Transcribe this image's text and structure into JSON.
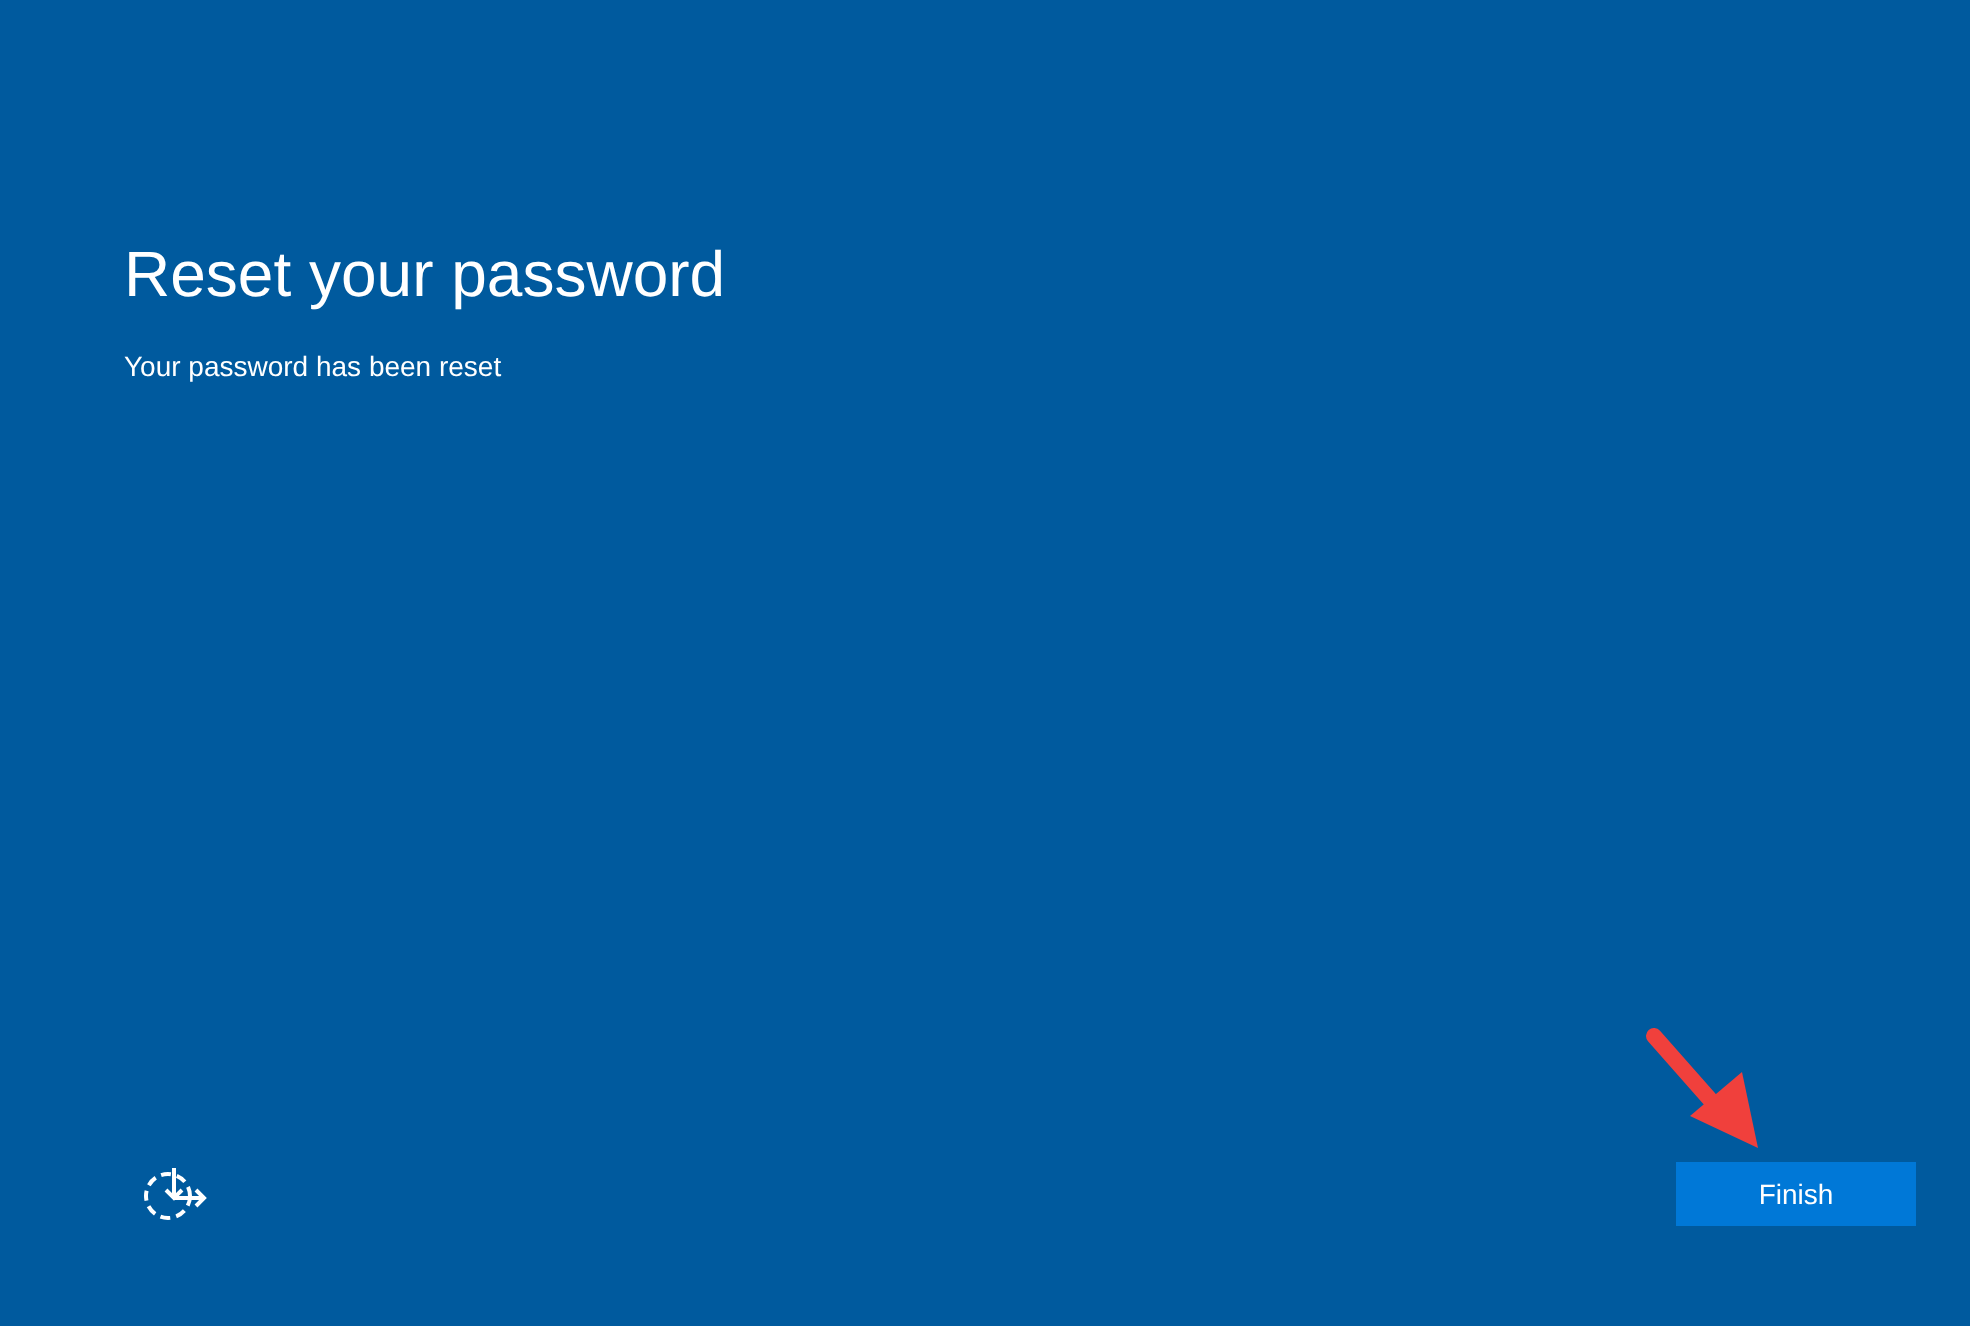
{
  "title": "Reset your password",
  "message": "Your password has been reset",
  "buttons": [
    {
      "label": "Finish"
    }
  ]
}
